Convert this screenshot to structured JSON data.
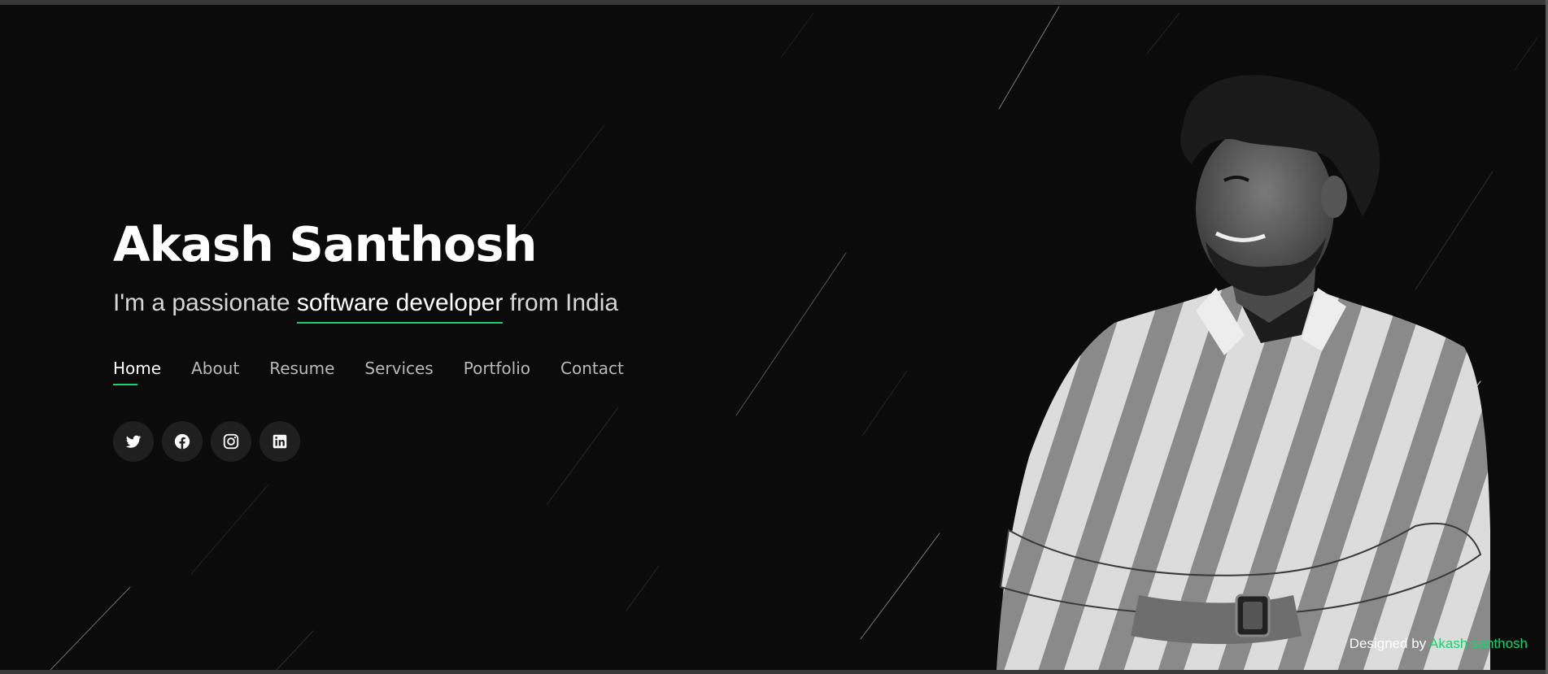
{
  "hero": {
    "name": "Akash Santhosh",
    "tagline_prefix": "I'm a passionate ",
    "tagline_role": "software developer",
    "tagline_suffix": " from India"
  },
  "nav": {
    "items": [
      {
        "label": "Home",
        "active": true
      },
      {
        "label": "About",
        "active": false
      },
      {
        "label": "Resume",
        "active": false
      },
      {
        "label": "Services",
        "active": false
      },
      {
        "label": "Portfolio",
        "active": false
      },
      {
        "label": "Contact",
        "active": false
      }
    ]
  },
  "social": {
    "icons": [
      "twitter-icon",
      "facebook-icon",
      "instagram-icon",
      "linkedin-icon"
    ]
  },
  "footer": {
    "prefix": "Designed by ",
    "author": "Akash santhosh"
  },
  "colors": {
    "background": "#0b0b0b",
    "accent": "#18d26e",
    "text": "#ffffff",
    "muted_text": "#b9b9b9"
  }
}
